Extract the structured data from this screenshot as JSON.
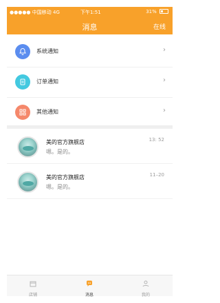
{
  "status_bar": {
    "carrier": "●●●●● 中国移动 4G",
    "time": "下午1:51",
    "battery": "31%"
  },
  "nav": {
    "title": "消息",
    "right": "在线"
  },
  "notifications": [
    {
      "label": "系统通知",
      "icon": "bell-icon",
      "color": "#5b8def"
    },
    {
      "label": "订单通知",
      "icon": "clipboard-icon",
      "color": "#43c9e0"
    },
    {
      "label": "其他通知",
      "icon": "grid-icon",
      "color": "#f5886b"
    }
  ],
  "chats": [
    {
      "name": "美的官方旗舰店",
      "message": "嗯。是的。",
      "time": "13: 52"
    },
    {
      "name": "美的官方旗舰店",
      "message": "嗯。是的。",
      "time": "11–20"
    }
  ],
  "tabs": [
    {
      "label": "店铺",
      "icon": "store-icon"
    },
    {
      "label": "消息",
      "icon": "chat-bubble-icon"
    },
    {
      "label": "我的",
      "icon": "person-icon"
    }
  ],
  "colors": {
    "primary": "#f8a12a",
    "divider": "#efefef"
  }
}
